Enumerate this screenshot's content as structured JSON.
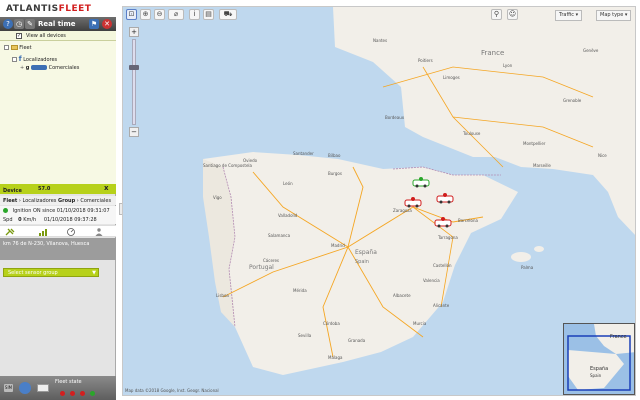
{
  "app": {
    "logo_part1": "ATLANTIS",
    "logo_part2": "FLEET",
    "realtime_label": "Real time"
  },
  "fleet_panel": {
    "view_all_label": "View all devices",
    "view_all_checked": true,
    "tree": {
      "root_label": "Fleet",
      "group_label": "Localizadores",
      "subgroup_label": "Comerciales"
    }
  },
  "device_panel": {
    "device_label": "Device",
    "device_name": "57.0",
    "close_glyph": "x",
    "breadcrumb": {
      "fleet": "Fleet",
      "group_prefix": "Localizadores",
      "group_label": "Group",
      "group_value": "Comerciales"
    },
    "ignition": "Ignition ON since 01/10/2018 09:31:07",
    "speed_label": "Spd",
    "speed_value": "0",
    "speed_unit": "Km/h",
    "speed_time": "01/10/2018 09:37:28",
    "address": "km 76 de N-230, Vilanova, Huesca",
    "sensor_group_placeholder": "Select sensor group"
  },
  "bottom_bar": {
    "fleet_state_label": "Fleet state"
  },
  "map": {
    "traffic_label": "Traffic",
    "map_type_label": "Map type",
    "copyright": "Map data ©2018 Google, Inst. Geogr. Nacional",
    "countries": [
      "France",
      "Portugal",
      "España",
      "Spain"
    ],
    "cities": [
      "Nantes",
      "Poitiers",
      "Limoges",
      "Bordeaux",
      "Toulouse",
      "Montpellier",
      "Lyon",
      "Genève",
      "Grenoble",
      "Marseille",
      "Nice",
      "Oviedo",
      "Santander",
      "Bilbao",
      "Santiago de Compostela",
      "Vigo",
      "León",
      "Burgos",
      "Valladolid",
      "Salamanca",
      "Zaragoza",
      "Barcelona",
      "Tarragona",
      "Madrid",
      "Castellón",
      "Valencia",
      "Cáceres",
      "Mérida",
      "Albacete",
      "Lisboa",
      "Sevilla",
      "Córdoba",
      "Murcia",
      "Alicante",
      "Granada",
      "Málaga",
      "Palma"
    ],
    "overview_labels": [
      "France",
      "España",
      "Spain"
    ],
    "vehicles_count": 4
  },
  "colors": {
    "accent_green": "#b7d11a",
    "brand_red": "#d21f1f",
    "vehicle_red": "#d01d1d",
    "vehicle_green": "#2aa62a"
  }
}
